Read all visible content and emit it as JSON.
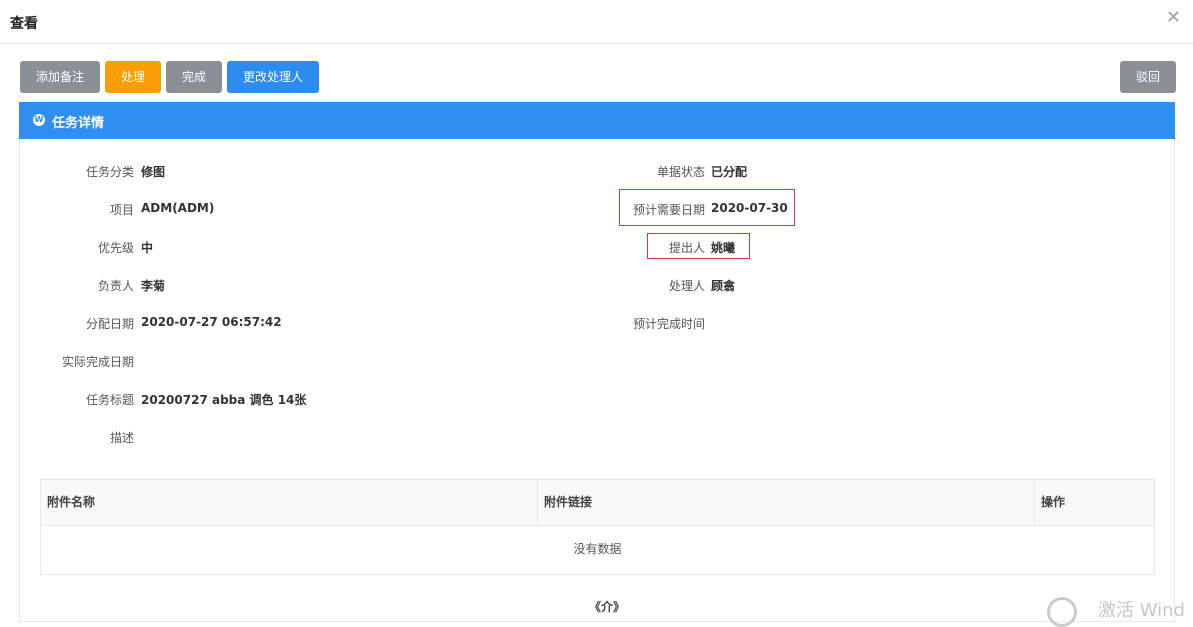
{
  "dialog": {
    "title": "查看",
    "close_icon": "close-icon"
  },
  "toolbar": {
    "add_note": "添加备注",
    "process": "处理",
    "complete": "完成",
    "change_handler": "更改处理人",
    "reject": "驳回"
  },
  "colors": {
    "gray_button": "#8b9096",
    "orange_button": "#fa9d06",
    "blue_button": "#2d8cf0",
    "panel_header": "#2e8ff0",
    "highlight_border": "#d9363e"
  },
  "panel": {
    "title": "任务详情",
    "icon": "wordpress-icon"
  },
  "fields": {
    "category": {
      "label": "任务分类",
      "value": "修图"
    },
    "project": {
      "label": "项目",
      "value": "ADM(ADM)"
    },
    "priority": {
      "label": "优先级",
      "value": "中"
    },
    "owner": {
      "label": "负责人",
      "value": "李菊"
    },
    "assign_date": {
      "label": "分配日期",
      "value": "2020-07-27 06:57:42"
    },
    "actual_finish": {
      "label": "实际完成日期",
      "value": ""
    },
    "task_title": {
      "label": "任务标题",
      "value": "20200727 abba 调色 14张"
    },
    "description": {
      "label": "描述",
      "value": ""
    },
    "doc_status": {
      "label": "单据状态",
      "value": "已分配"
    },
    "expected_date": {
      "label": "预计需要日期",
      "value": "2020-07-30"
    },
    "proposer": {
      "label": "提出人",
      "value": "姚曦"
    },
    "handler": {
      "label": "处理人",
      "value": "顾翕"
    },
    "expected_finish": {
      "label": "预计完成时间",
      "value": ""
    }
  },
  "attachments": {
    "columns": [
      "附件名称",
      "附件链接",
      "操作"
    ],
    "empty_text": "没有数据"
  },
  "footer": {
    "glyph": "《介》"
  },
  "watermark": {
    "text": "激活 Wind"
  }
}
